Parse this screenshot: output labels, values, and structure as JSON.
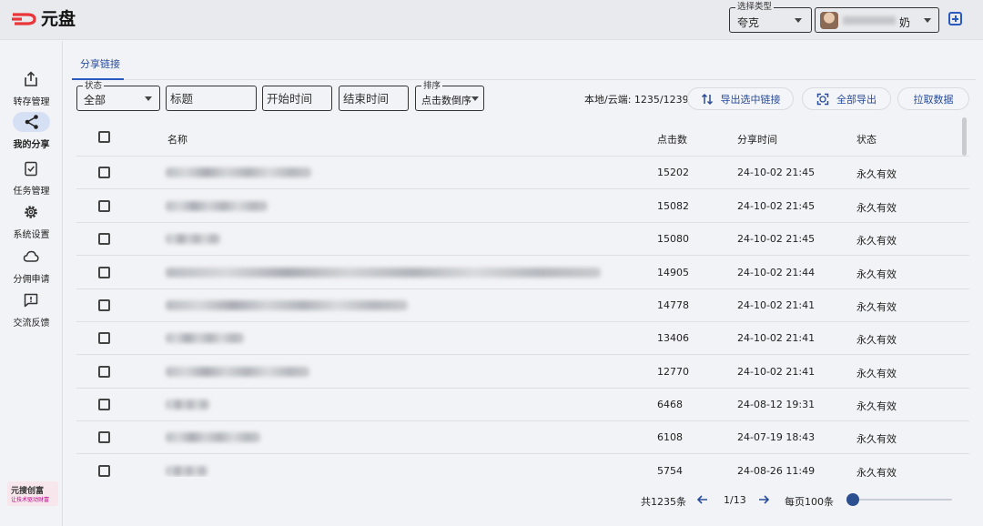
{
  "app": {
    "logo_text": "元盘"
  },
  "header": {
    "type_select": {
      "label": "选择类型",
      "value": "夸克"
    },
    "account_select": {
      "name_suffix": "奶"
    }
  },
  "sidebar": {
    "items": [
      {
        "label": "转存管理",
        "icon": "share-upload-icon"
      },
      {
        "label": "我的分享",
        "icon": "share-icon",
        "active": true
      },
      {
        "label": "任务管理",
        "icon": "task-check-icon"
      },
      {
        "label": "系统设置",
        "icon": "gear-icon"
      },
      {
        "label": "分佣申请",
        "icon": "cloud-icon"
      },
      {
        "label": "交流反馈",
        "icon": "feedback-icon"
      }
    ],
    "brand": {
      "title": "元搜创富",
      "subtitle": "让技术驱动财富"
    }
  },
  "tabs": [
    {
      "label": "分享链接",
      "active": true
    }
  ],
  "filters": {
    "status": {
      "label": "状态",
      "value": "全部"
    },
    "title": {
      "placeholder": "标题"
    },
    "start_time": {
      "placeholder": "开始时间"
    },
    "end_time": {
      "placeholder": "结束时间"
    },
    "sort": {
      "label": "排序",
      "value": "点击数倒序"
    }
  },
  "toolbar": {
    "count_text": "本地/云端: 1235/1239",
    "export_selected": "导出选中链接",
    "export_all": "全部导出",
    "fetch": "拉取数据"
  },
  "table": {
    "columns": {
      "name": "名称",
      "clicks": "点击数",
      "time": "分享时间",
      "status": "状态"
    },
    "rows": [
      {
        "clicks": "15202",
        "time": "24-10-02 21:45",
        "status": "永久有效"
      },
      {
        "clicks": "15082",
        "time": "24-10-02 21:45",
        "status": "永久有效"
      },
      {
        "clicks": "15080",
        "time": "24-10-02 21:45",
        "status": "永久有效"
      },
      {
        "clicks": "14905",
        "time": "24-10-02 21:44",
        "status": "永久有效"
      },
      {
        "clicks": "14778",
        "time": "24-10-02 21:41",
        "status": "永久有效"
      },
      {
        "clicks": "13406",
        "time": "24-10-02 21:41",
        "status": "永久有效"
      },
      {
        "clicks": "12770",
        "time": "24-10-02 21:41",
        "status": "永久有效"
      },
      {
        "clicks": "6468",
        "time": "24-08-12 19:31",
        "status": "永久有效"
      },
      {
        "clicks": "6108",
        "time": "24-07-19 18:43",
        "status": "永久有效"
      },
      {
        "clicks": "5754",
        "time": "24-08-26 11:49",
        "status": "永久有效"
      }
    ]
  },
  "pagination": {
    "total": "共1235条",
    "page": "1/13",
    "per_page": "每页100条",
    "slider_level": 0
  },
  "colors": {
    "accent": "#2a5ac0",
    "logo_red": "#e8363b",
    "nav_active_bg": "#d6e0f5"
  }
}
